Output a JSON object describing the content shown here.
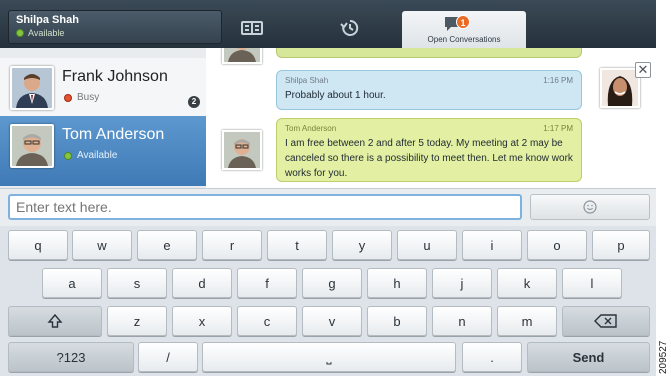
{
  "user": {
    "name": "Shilpa Shah",
    "status": "Available"
  },
  "top_tabs": [
    {
      "icon": "directory-icon"
    },
    {
      "icon": "recents-icon"
    },
    {
      "icon": "chat-bubble-icon",
      "label": "Open Conversations",
      "badge": "1"
    }
  ],
  "contacts": [
    {
      "name": "Frank Johnson",
      "status": "Busy",
      "status_color": "#e3542f",
      "count": "2"
    },
    {
      "name": "Tom Anderson",
      "status": "Available",
      "status_color": "#86c543"
    }
  ],
  "messages": [
    {
      "sender": "Shilpa Shah",
      "time": "1:16 PM",
      "text": "Probably about 1 hour."
    },
    {
      "sender": "Tom Anderson",
      "time": "1:17 PM",
      "text": "I am free between 2 and after 5 today. My meeting at 2 may be canceled so there is a possibility to meet then. Let me know work works for you."
    }
  ],
  "input": {
    "placeholder": "Enter text here."
  },
  "keyboard": {
    "row1": [
      "q",
      "w",
      "e",
      "r",
      "t",
      "y",
      "u",
      "i",
      "o",
      "p"
    ],
    "row2": [
      "a",
      "s",
      "d",
      "f",
      "g",
      "h",
      "j",
      "k",
      "l"
    ],
    "row3": [
      "z",
      "x",
      "c",
      "v",
      "b",
      "n",
      "m"
    ],
    "numbers_label": "?123",
    "slash_label": "/",
    "space_label": "⎵",
    "period_label": ".",
    "send_label": "Send"
  },
  "figure_id": "209527"
}
